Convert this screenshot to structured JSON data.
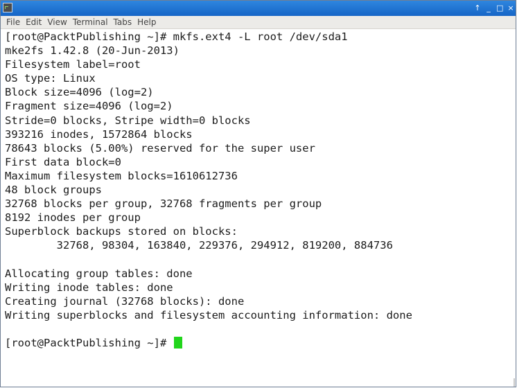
{
  "window": {
    "icon": "terminal-app-icon",
    "controls": {
      "up": "↑",
      "minimize": "_",
      "maximize": "□",
      "close": "×"
    }
  },
  "menubar": {
    "items": [
      "File",
      "Edit",
      "View",
      "Terminal",
      "Tabs",
      "Help"
    ]
  },
  "terminal": {
    "lines": [
      "[root@PacktPublishing ~]# mkfs.ext4 -L root /dev/sda1",
      "mke2fs 1.42.8 (20-Jun-2013)",
      "Filesystem label=root",
      "OS type: Linux",
      "Block size=4096 (log=2)",
      "Fragment size=4096 (log=2)",
      "Stride=0 blocks, Stripe width=0 blocks",
      "393216 inodes, 1572864 blocks",
      "78643 blocks (5.00%) reserved for the super user",
      "First data block=0",
      "Maximum filesystem blocks=1610612736",
      "48 block groups",
      "32768 blocks per group, 32768 fragments per group",
      "8192 inodes per group",
      "Superblock backups stored on blocks:",
      "        32768, 98304, 163840, 229376, 294912, 819200, 884736",
      "",
      "Allocating group tables: done",
      "Writing inode tables: done",
      "Creating journal (32768 blocks): done",
      "Writing superblocks and filesystem accounting information: done",
      "",
      "[root@PacktPublishing ~]# "
    ],
    "cursor_color": "#22d51c"
  },
  "colors": {
    "titlebar": "#1f72d3",
    "menubar_bg": "#ecebe8",
    "text": "#1b1b1b"
  }
}
